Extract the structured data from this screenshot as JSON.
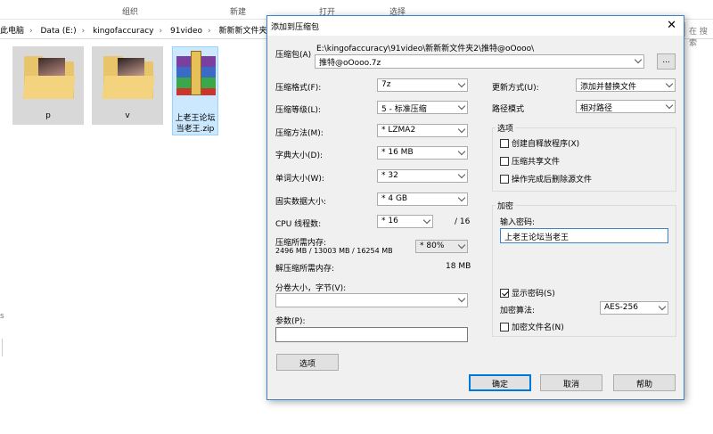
{
  "explorer": {
    "ribbon": {
      "tab1": "组织",
      "tab2": "新建",
      "tab3": "打开",
      "tab4": "选择"
    },
    "address": {
      "crumbs": [
        "此电脑",
        "Data (E:)",
        "kingofaccuracy",
        "91video",
        "新新新文件夹2"
      ],
      "separator": "›",
      "search_placeholder": "在 搜索"
    },
    "files": [
      {
        "label": "p"
      },
      {
        "label": "v"
      },
      {
        "label": "上老王论坛当老王.zip"
      }
    ],
    "left_mark": "s"
  },
  "dialog": {
    "title": "添加到压缩包",
    "archive": {
      "label": "压缩包(A)",
      "path_line": "E:\\kingofaccuracy\\91video\\新新新文件夹2\\推特@oOooo\\",
      "filename": "推特@oOooo.7z",
      "browse_label": "..."
    },
    "left": {
      "format": {
        "label": "压缩格式(F):",
        "value": "7z"
      },
      "level": {
        "label": "压缩等级(L):",
        "value": "5 - 标准压缩"
      },
      "method": {
        "label": "压缩方法(M):",
        "value": "* LZMA2"
      },
      "dict": {
        "label": "字典大小(D):",
        "value": "* 16 MB"
      },
      "word": {
        "label": "单词大小(W):",
        "value": "* 32"
      },
      "solid": {
        "label": "固实数据大小:",
        "value": "* 4 GB"
      },
      "threads": {
        "label": "CPU 线程数:",
        "value": "* 16",
        "max": "/ 16"
      },
      "mem_compress": {
        "label": "压缩所需内存:",
        "detail": "2496 MB / 13003 MB / 16254 MB",
        "value": "* 80%"
      },
      "mem_decompress": {
        "label": "解压缩所需内存:",
        "value": "18 MB"
      },
      "split": {
        "label": "分卷大小，字节(V):",
        "value": ""
      },
      "params": {
        "label": "参数(P):",
        "value": ""
      },
      "options_button": "选项"
    },
    "right": {
      "update": {
        "label": "更新方式(U):",
        "value": "添加并替换文件"
      },
      "pathmode": {
        "label": "路径模式",
        "value": "相对路径"
      },
      "options_group": {
        "title": "选项",
        "items": [
          {
            "label": "创建自释放程序(X)",
            "checked": false
          },
          {
            "label": "压缩共享文件",
            "checked": false
          },
          {
            "label": "操作完成后删除源文件",
            "checked": false
          }
        ]
      },
      "encrypt_group": {
        "title": "加密",
        "password_label": "输入密码:",
        "password_value": "上老王论坛当老王",
        "show_password": {
          "label": "显示密码(S)",
          "checked": true
        },
        "method": {
          "label": "加密算法:",
          "value": "AES-256"
        },
        "encrypt_names": {
          "label": "加密文件名(N)",
          "checked": false
        }
      }
    },
    "buttons": {
      "ok": "确定",
      "cancel": "取消",
      "help": "帮助"
    }
  }
}
